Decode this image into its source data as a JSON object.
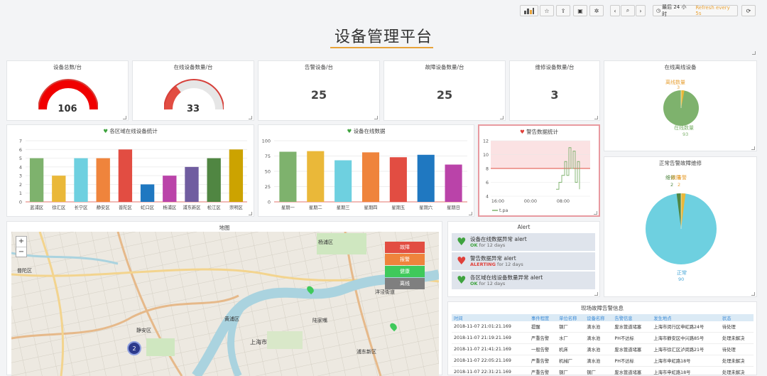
{
  "title": "设备管理平台",
  "toolbar": {
    "time_range": "最后 24 小时",
    "refresh": "Refresh every 5s"
  },
  "stats": [
    {
      "label": "设备总数/台",
      "value": "106",
      "gauge_fraction": 1.0
    },
    {
      "label": "在线设备数量/台",
      "value": "33",
      "gauge_fraction": 0.31
    },
    {
      "label": "告警设备/台",
      "value": "25"
    },
    {
      "label": "故障设备数量/台",
      "value": "25"
    },
    {
      "label": "维修设备数量/台",
      "value": "3"
    }
  ],
  "pie_online": {
    "title": "在线离线设备",
    "offline_label": "离线数量",
    "offline_value": "3",
    "online_label": "在线数量",
    "online_value": "93"
  },
  "pie_status": {
    "title": "正常告警故障维修",
    "labels": [
      "维修",
      "故障",
      "告警"
    ],
    "small_values": [
      "2",
      "2"
    ],
    "normal_label": "正常",
    "normal_value": "90"
  },
  "chart_data": [
    {
      "type": "bar",
      "title": "各区域在线设备统计",
      "categories": [
        "蓝浦区",
        "徐汇区",
        "长宁区",
        "静安区",
        "普陀区",
        "虹口区",
        "杨浦区",
        "浦东新区",
        "松江区",
        "崇明区"
      ],
      "values": [
        5,
        3,
        5,
        5,
        6,
        2,
        3,
        4,
        5,
        6
      ],
      "colors": [
        "#7eb26d",
        "#eab839",
        "#6ed0e0",
        "#ef843c",
        "#e24d42",
        "#1f78c1",
        "#ba43a9",
        "#705da0",
        "#508642",
        "#cca300"
      ],
      "yticks": [
        0,
        1,
        2,
        3,
        4,
        5,
        6,
        7
      ],
      "ylim": [
        0,
        7
      ]
    },
    {
      "type": "bar",
      "title": "设备在线数据",
      "categories": [
        "星期一",
        "星期二",
        "星期三",
        "星期四",
        "星期五",
        "星期六",
        "星期日"
      ],
      "values": [
        82,
        83,
        68,
        81,
        73,
        77,
        61
      ],
      "colors": [
        "#7eb26d",
        "#eab839",
        "#6ed0e0",
        "#ef843c",
        "#e24d42",
        "#1f78c1",
        "#ba43a9"
      ],
      "yticks": [
        0,
        25,
        50,
        75,
        100
      ],
      "ylim": [
        0,
        100
      ]
    },
    {
      "type": "line",
      "title": "警告数据统计",
      "series": [
        {
          "name": "t.pa"
        }
      ],
      "xticks": [
        "16:00",
        "00:00",
        "08:00"
      ],
      "yticks": [
        4,
        6,
        8,
        10,
        12
      ],
      "ylim": [
        4,
        12
      ],
      "threshold": 8
    }
  ],
  "map": {
    "title": "地图",
    "zoom_in": "+",
    "zoom_out": "−",
    "legend": [
      {
        "label": "故障",
        "color": "#e24d42"
      },
      {
        "label": "报警",
        "color": "#ef843c"
      },
      {
        "label": "健康",
        "color": "#3fc95b"
      },
      {
        "label": "离线",
        "color": "#7f7f7f"
      }
    ],
    "places": [
      "杨浦区",
      "普陀区",
      "静安区",
      "黄浦区",
      "上海市",
      "洋泾街道",
      "浦东新区",
      "陆家嘴"
    ],
    "cluster_count": "2"
  },
  "alert": {
    "title": "Alert",
    "items": [
      {
        "name": "设备在线数据异常 alert",
        "state": "OK",
        "state_color": "#3fa33f",
        "dur": "for 12 days",
        "icon": "heart-ok-icon"
      },
      {
        "name": "警告数据异常 alert",
        "state": "ALERTING",
        "state_color": "#e0403a",
        "dur": "for 12 days",
        "icon": "heart-broken-icon"
      },
      {
        "name": "各区域在线设备数量异常 alert",
        "state": "OK",
        "state_color": "#3fa33f",
        "dur": "for 12 days",
        "icon": "heart-ok-icon"
      }
    ]
  },
  "faults": {
    "title": "现场故障告警信息",
    "headers": [
      "时间",
      "事件程度",
      "单位名称",
      "设备名称",
      "告警信息",
      "发生地点",
      "状态"
    ],
    "rows": [
      [
        "2018-11-07 21:01:21.169",
        "提醒",
        "钢厂",
        "滴水池",
        "废水管道堵塞",
        "上海市闵行区申虹路24号",
        "待处理"
      ],
      [
        "2018-11-07 21:19:21.169",
        "严重告警",
        "水厂",
        "滴水池",
        "PH不达标",
        "上海市静安区中兴路85号",
        "处理未解决"
      ],
      [
        "2018-11-07 21:41:21.169",
        "一般告警",
        "机床",
        "滴水池",
        "废水管道堵塞",
        "上海市徐汇区泸闵路21号",
        "待处理"
      ],
      [
        "2018-11-07 22:05:21.169",
        "严重告警",
        "机械厂",
        "滴水池",
        "PH不达标",
        "上海市申虹路18号",
        "处理未解决"
      ],
      [
        "2018-11-07 22:31:21.169",
        "严重告警",
        "钢厂",
        "钢厂",
        "废水管道堵塞",
        "上海市申虹路18号",
        "处理未解决"
      ]
    ]
  }
}
